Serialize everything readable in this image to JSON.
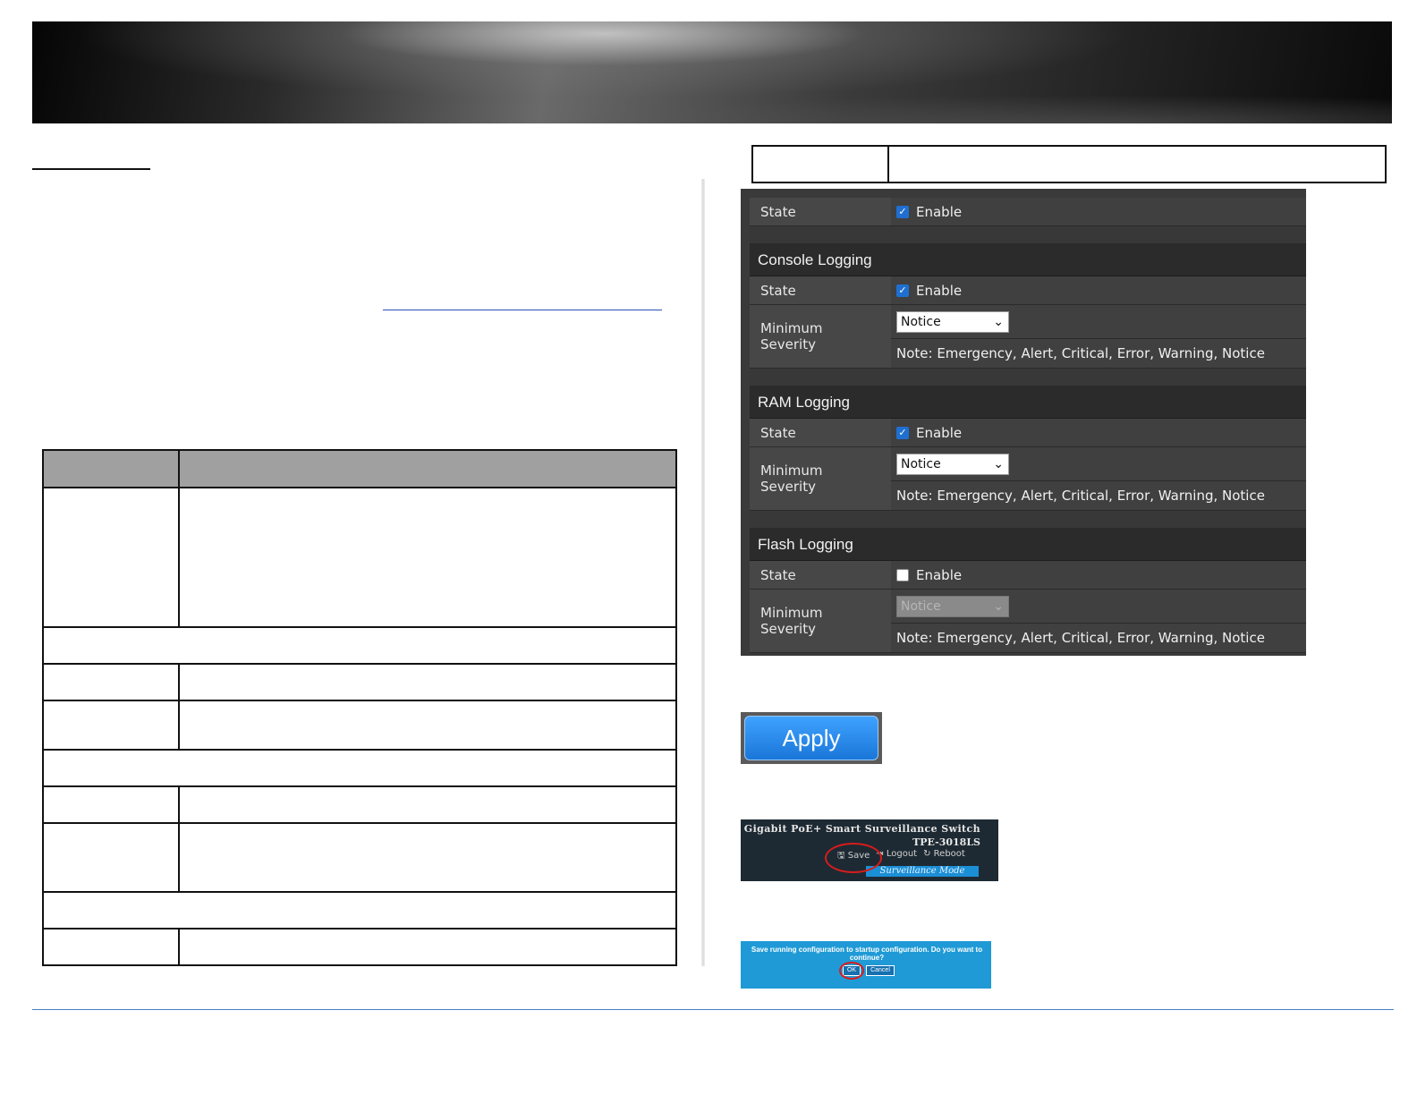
{
  "panel": {
    "system_state_label": "State",
    "system_state_value": "Enable",
    "sections": [
      {
        "title": "Console Logging",
        "state_label": "State",
        "state_value": "Enable",
        "checked": true,
        "severity_label_1": "Minimum",
        "severity_label_2": "Severity",
        "severity_value": "Notice",
        "disabled": false,
        "note": "Note: Emergency, Alert, Critical, Error, Warning, Notice"
      },
      {
        "title": "RAM Logging",
        "state_label": "State",
        "state_value": "Enable",
        "checked": true,
        "severity_label_1": "Minimum",
        "severity_label_2": "Severity",
        "severity_value": "Notice",
        "disabled": false,
        "note": "Note: Emergency, Alert, Critical, Error, Warning, Notice"
      },
      {
        "title": "Flash Logging",
        "state_label": "State",
        "state_value": "Enable",
        "checked": false,
        "severity_label_1": "Minimum",
        "severity_label_2": "Severity",
        "severity_value": "Notice",
        "disabled": true,
        "note": "Note: Emergency, Alert, Critical, Error, Warning, Notice"
      }
    ]
  },
  "apply_label": "Apply",
  "header_thumb": {
    "title": "Gigabit PoE+ Smart Surveillance Switch",
    "model": "TPE-3018LS",
    "save": "Save",
    "logout": "Logout",
    "reboot": "Reboot",
    "mode": "Surveillance Mode"
  },
  "dialog_thumb": {
    "message": "Save running configuration to startup configuration. Do you want to continue?",
    "ok": "OK",
    "cancel": "Cancel"
  }
}
